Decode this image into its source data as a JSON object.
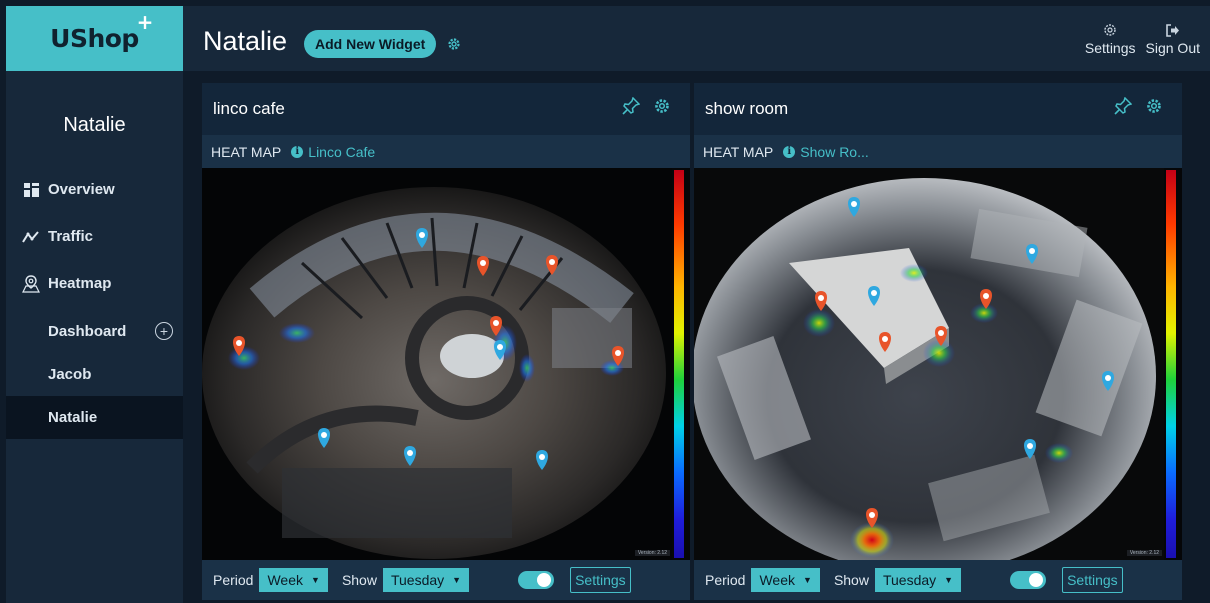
{
  "brand": {
    "logo": "UShop",
    "logo_mark": "+"
  },
  "sidebar": {
    "user": "Natalie",
    "nav": [
      {
        "label": "Overview",
        "icon": "overview-icon"
      },
      {
        "label": "Traffic",
        "icon": "traffic-icon"
      },
      {
        "label": "Heatmap",
        "icon": "heatmap-icon"
      }
    ],
    "dashboards": [
      {
        "label": "Dashboard",
        "active": false
      },
      {
        "label": "Jacob",
        "active": false
      },
      {
        "label": "Natalie",
        "active": true
      }
    ],
    "add_icon": "plus-circle-icon"
  },
  "header": {
    "title": "Natalie",
    "add_widget_label": "Add New Widget",
    "settings_label": "Settings",
    "signout_label": "Sign Out"
  },
  "widgets": [
    {
      "title": "linco cafe",
      "type_label": "HEAT MAP",
      "source": "Linco Cafe",
      "period_label": "Period",
      "period_value": "Week",
      "show_label": "Show",
      "show_value": "Tuesday",
      "toggle_on": true,
      "settings_label": "Settings",
      "version": "Version: 2.12"
    },
    {
      "title": "show room",
      "type_label": "HEAT MAP",
      "source": "Show Ro...",
      "period_label": "Period",
      "period_value": "Week",
      "show_label": "Show",
      "show_value": "Tuesday",
      "toggle_on": true,
      "settings_label": "Settings",
      "version": "Version: 2.12"
    }
  ],
  "colors": {
    "accent": "#46bfc8",
    "panel": "#17283a",
    "background": "#0f1b29",
    "marker_blue": "#2fa8e0",
    "marker_orange": "#e8542a"
  }
}
